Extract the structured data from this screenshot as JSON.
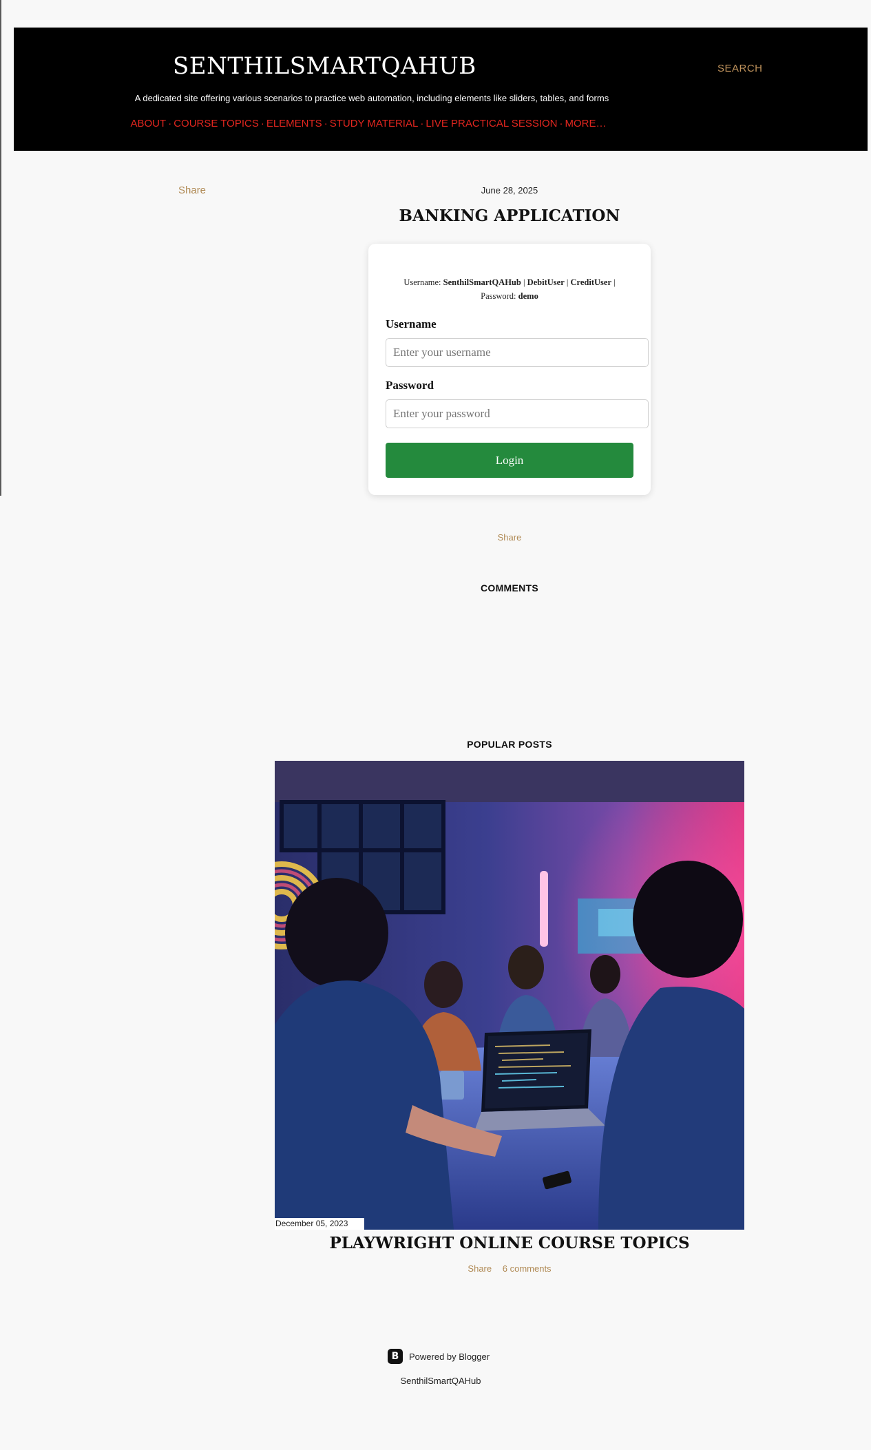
{
  "header": {
    "site_title": "SENTHILSMARTQAHUB",
    "search_label": "SEARCH",
    "tagline": "A dedicated site offering various scenarios to practice web automation, including elements like sliders, tables, and forms",
    "nav": [
      "ABOUT",
      "COURSE TOPICS",
      "ELEMENTS",
      "STUDY MATERIAL",
      "LIVE PRACTICAL SESSION",
      "MORE…"
    ],
    "nav_separator": "·"
  },
  "post": {
    "share_label": "Share",
    "date": "June 28, 2025",
    "title": "BANKING APPLICATION",
    "share_bottom_label": "Share"
  },
  "login": {
    "creds_username_prefix": "Username:",
    "creds_user1": "SenthilSmartQAHub",
    "creds_user2": "DebitUser",
    "creds_user3": "CreditUser",
    "creds_sep": "|",
    "creds_password_prefix": "Password:",
    "creds_password": "demo",
    "username_label": "Username",
    "username_placeholder": "Enter your username",
    "username_value": "",
    "password_label": "Password",
    "password_placeholder": "Enter your password",
    "password_value": "",
    "login_button": "Login",
    "button_color": "#248a3d"
  },
  "comments": {
    "heading": "COMMENTS"
  },
  "popular": {
    "heading": "POPULAR POSTS",
    "image_icon": "team-coding-meeting-photo",
    "date": "December 05, 2023",
    "title": "PLAYWRIGHT ONLINE COURSE TOPICS",
    "share_label": "Share",
    "comments_label": "6 comments"
  },
  "footer": {
    "powered_by": "Powered by Blogger",
    "blogger_icon": "blogger-icon",
    "blog_name": "SenthilSmartQAHub"
  },
  "colors": {
    "header_bg": "#000000",
    "accent": "#c0935c",
    "nav": "#e2261f"
  }
}
